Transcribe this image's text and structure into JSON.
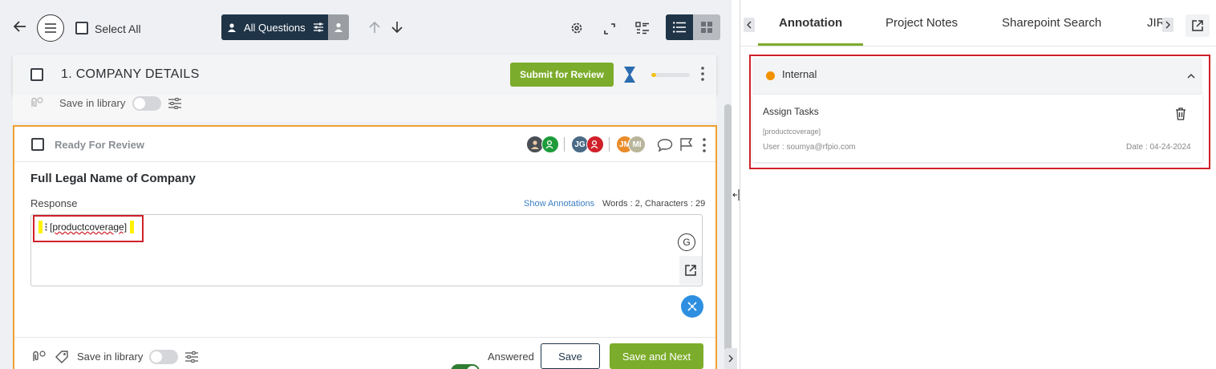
{
  "toolbar": {
    "select_all": "Select All",
    "all_questions": "All Questions"
  },
  "section": {
    "title": "1. COMPANY DETAILS",
    "submit_label": "Submit for Review",
    "progress": 0.12
  },
  "library_top": {
    "label": "Save in library"
  },
  "question": {
    "status": "Ready For Review",
    "avatars": [
      {
        "initials": "JG",
        "color": "#4a6a86"
      },
      {
        "initials": "JM",
        "color": "#e98c2b"
      },
      {
        "initials": "MI",
        "color": "#b8b59b"
      }
    ],
    "title": "Full Legal Name of Company",
    "response_label": "Response",
    "show_annotations": "Show Annotations",
    "word_count": "Words : 2, Characters : 29",
    "response_text": "[productcoverage]",
    "grammar_badge": "G"
  },
  "footer": {
    "save_in_library": "Save in library",
    "answered": "Answered",
    "save": "Save",
    "save_next": "Save and Next"
  },
  "right_pane": {
    "tabs": [
      "Annotation",
      "Project Notes",
      "Sharepoint Search",
      "JIR"
    ],
    "annotation": {
      "group": "Internal",
      "group_color": "#f39200",
      "title": "Assign Tasks",
      "tag": "[productcoverage]",
      "user": "User : soumya@rfpio.com",
      "date": "Date : 04-24-2024"
    }
  },
  "colors": {
    "accent_green": "#7cac2b",
    "dark_blue": "#1f3447",
    "highlight_red": "#d0202a",
    "blue_link": "#3c7fc0"
  }
}
